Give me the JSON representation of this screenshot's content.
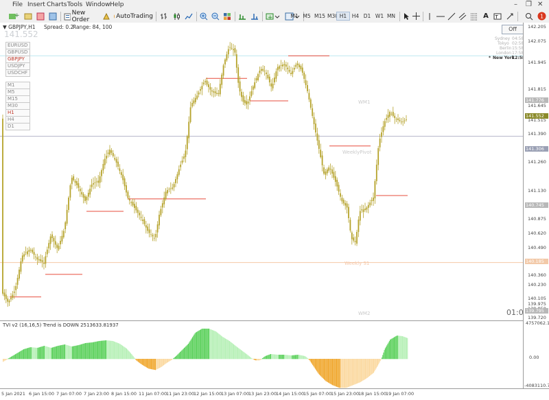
{
  "menu": [
    "File",
    "Insert",
    "Charts",
    "Tools",
    "Window",
    "Help"
  ],
  "toolbar": {
    "new_order": "New Order",
    "auto_trading": "AutoTrading",
    "timeframes": [
      "M1",
      "M5",
      "M15",
      "M30",
      "H1",
      "H4",
      "D1",
      "W1",
      "MN"
    ],
    "active_timeframe": "H1",
    "notification_count": "1"
  },
  "chart": {
    "symbol": "GBPJPY,H1",
    "spread": "Spread: 0.2",
    "range": "Range: 84, 100",
    "current_price": "141.552",
    "pairs": [
      "EURUSD",
      "GBPUSD",
      "GBPJPY",
      "USDJPY",
      "USDCHF"
    ],
    "selected_pair": "GBPJPY",
    "timeframe_buttons": [
      "M1",
      "M5",
      "M15",
      "M30",
      "H1",
      "H4",
      "D1"
    ],
    "selected_timeframe": "H1",
    "off_button": "Off",
    "sessions": [
      {
        "city": "Sydney",
        "time": "04:58"
      },
      {
        "city": "Tokyo",
        "time": "02:58"
      },
      {
        "city": "Berlin",
        "time": "15:58"
      },
      {
        "city": "London",
        "time": "17:58"
      },
      {
        "city": "New York",
        "time": "12:58"
      }
    ],
    "active_session": "New York",
    "active_session_marker": "*",
    "level_labels": {
      "wm1": "WM1",
      "weekly_pivot": "WeeklyPivot",
      "weekly_s1": "Weekly S1",
      "wm2": "WM2"
    },
    "countdown": "01:07",
    "price_axis": [
      "142.205",
      "142.075",
      "141.945",
      "141.815",
      "141.645",
      "141.515",
      "141.390",
      "141.260",
      "141.130",
      "140.875",
      "140.620",
      "140.490",
      "140.360",
      "140.230",
      "140.105",
      "139.975",
      "139.850",
      "139.720"
    ],
    "price_tags": [
      {
        "label": "141.776",
        "bg": "#b8b8b8",
        "fg": "#ffffff",
        "price": 141.776
      },
      {
        "label": "141.552",
        "bg": "#8a8a2a",
        "fg": "#ffffff",
        "price": 141.552
      },
      {
        "label": "141.306",
        "bg": "#9aa0b4",
        "fg": "#ffffff",
        "price": 141.306
      },
      {
        "label": "140.745",
        "bg": "#b8b8b8",
        "fg": "#ffffff",
        "price": 140.745
      },
      {
        "label": "140.185",
        "bg": "#f2c9a8",
        "fg": "#ffffff",
        "price": 140.185
      },
      {
        "label": "139.795",
        "bg": "#b8b8b8",
        "fg": "#ffffff",
        "price": 139.795
      }
    ],
    "candle_color": "#b5a22a",
    "colors": {
      "daily_level": "#e74c3c",
      "weekly_pivot": "#b4b4c8",
      "weekly_s1": "#f6c9a6",
      "wm1": "#bfe8f0"
    }
  },
  "indicator": {
    "title": "TVI v2 (16,16,5) Trend is DOWN 2513633.81937",
    "axis": [
      "4757062.1",
      "0.00",
      "-4083110.7"
    ],
    "up_color": "#5ed15e",
    "up_light": "#b7f0b7",
    "down_color": "#f0a830",
    "down_light": "#fbd9a0"
  },
  "time_axis": [
    "5 Jan 2021",
    "6 Jan 15:00",
    "7 Jan 07:00",
    "7 Jan 23:00",
    "8 Jan 15:00",
    "11 Jan 07:00",
    "11 Jan 23:00",
    "12 Jan 15:00",
    "13 Jan 07:00",
    "13 Jan 23:00",
    "14 Jan 15:00",
    "15 Jan 07:00",
    "15 Jan 23:00",
    "18 Jan 15:00",
    "19 Jan 07:00"
  ]
}
